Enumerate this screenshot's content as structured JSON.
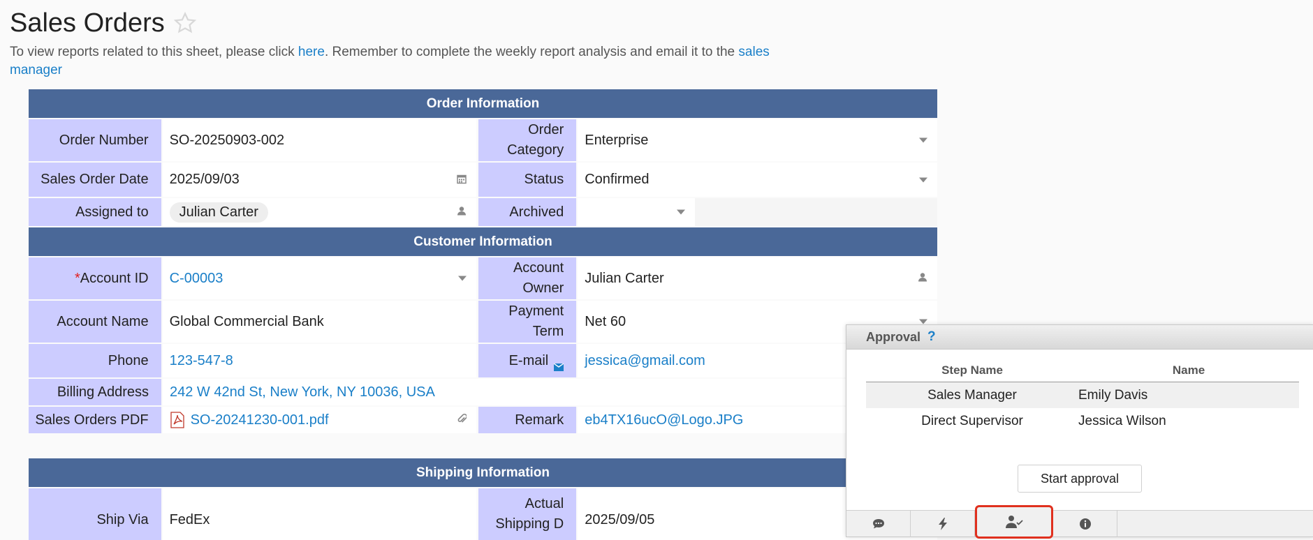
{
  "header": {
    "title": "Sales Orders",
    "intro_before": "To view reports related to this sheet, please click ",
    "intro_link1": "here",
    "intro_middle": ". Remember to complete the weekly report analysis and email it to the ",
    "intro_link2": "sales manager"
  },
  "order_info": {
    "section_title": "Order Information",
    "order_number_label": "Order Number",
    "order_number": "SO-20250903-002",
    "order_category_label": "Order Category",
    "order_category": "Enterprise",
    "sales_order_date_label": "Sales Order Date",
    "sales_order_date": "2025/09/03",
    "status_label": "Status",
    "status": "Confirmed",
    "assigned_to_label": "Assigned to",
    "assigned_to": "Julian Carter",
    "archived_label": "Archived",
    "archived": ""
  },
  "customer_info": {
    "section_title": "Customer Information",
    "required_mark": "*",
    "account_id_label": "Account ID",
    "account_id": "C-00003",
    "account_owner_label": "Account Owner",
    "account_owner": "Julian Carter",
    "account_name_label": "Account Name",
    "account_name": "Global Commercial Bank",
    "payment_term_label": "Payment Term",
    "payment_term": "Net 60",
    "phone_label": "Phone",
    "phone": "123-547-8",
    "email_label": "E-mail",
    "email": "jessica@gmail.com",
    "billing_address_label": "Billing Address",
    "billing_address": "242 W 42nd St, New York, NY 10036, USA",
    "pdf_label": "Sales Orders PDF",
    "pdf_file": "SO-20241230-001.pdf",
    "remark_label": "Remark",
    "remark": "eb4TX16ucO@Logo.JPG"
  },
  "shipping_info": {
    "section_title": "Shipping Information",
    "ship_via_label": "Ship Via",
    "ship_via": "FedEx",
    "actual_shipping_label": "Actual Shipping D",
    "actual_shipping": "2025/09/05"
  },
  "approval": {
    "title": "Approval",
    "help": "?",
    "col_step": "Step Name",
    "col_name": "Name",
    "rows": [
      {
        "step": "Sales Manager",
        "name": "Emily Davis"
      },
      {
        "step": "Direct Supervisor",
        "name": "Jessica Wilson"
      }
    ],
    "start_button": "Start approval",
    "toolbar_icons": [
      "comment-icon",
      "lightning-icon",
      "user-check-icon",
      "info-icon"
    ],
    "active_tab": "user-check-icon"
  },
  "colors": {
    "section_header": "#4a6898",
    "label_bg": "#ccccff",
    "link": "#1a7fc8",
    "highlight": "#e0301e"
  }
}
